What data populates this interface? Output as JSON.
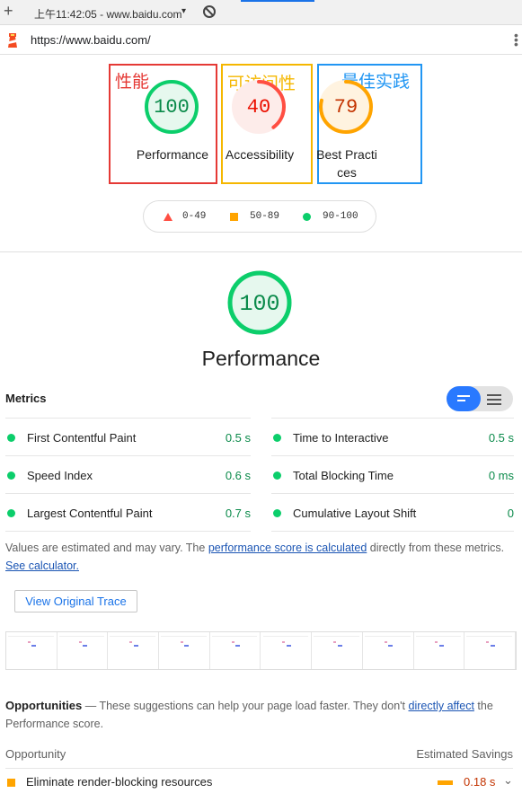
{
  "browser": {
    "tab_title": "上午11:42:05 - www.baidu.com",
    "url": "https://www.baidu.com/",
    "new_tab_glyph": "+",
    "menu_glyph": "⋮",
    "tab_caret": "▾"
  },
  "categories": [
    {
      "zh_label": "性能",
      "score": "100",
      "label": "Performance",
      "zh_color": "#e53935",
      "box_color": "#e53935",
      "score_color": "#0cce6b",
      "score_text_color": "#0a8a4a",
      "fill": 1.0
    },
    {
      "zh_label": "可访问性",
      "score": "40",
      "label": "Accessibility",
      "zh_color": "#f5b700",
      "box_color": "#f5b700",
      "score_color": "#ff4e42",
      "score_text_color": "#eb0f00",
      "fill": 0.4
    },
    {
      "zh_label": "最佳实践",
      "score": "79",
      "label": "Best Practices",
      "zh_color": "#2196f3",
      "box_color": "#2196f3",
      "score_color": "#ffa400",
      "score_text_color": "#c33300",
      "fill": 0.79
    }
  ],
  "legend": [
    {
      "range": "0-49",
      "shape": "triangle",
      "color": "#ff4e42"
    },
    {
      "range": "50-89",
      "shape": "square",
      "color": "#ffa400"
    },
    {
      "range": "90-100",
      "shape": "circle",
      "color": "#0cce6b"
    }
  ],
  "performance": {
    "score": "100",
    "title": "Performance",
    "fill": 1.0
  },
  "metrics": {
    "title": "Metrics",
    "left": [
      {
        "name": "First Contentful Paint",
        "value": "0.5 s"
      },
      {
        "name": "Speed Index",
        "value": "0.6 s"
      },
      {
        "name": "Largest Contentful Paint",
        "value": "0.7 s"
      }
    ],
    "right": [
      {
        "name": "Time to Interactive",
        "value": "0.5 s"
      },
      {
        "name": "Total Blocking Time",
        "value": "0 ms"
      },
      {
        "name": "Cumulative Layout Shift",
        "value": "0"
      }
    ]
  },
  "note": {
    "prefix": "Values are estimated and may vary. The ",
    "link1": "performance score is calculated",
    "middle": " directly from these metrics. ",
    "link2": "See calculator."
  },
  "trace_button": "View Original Trace",
  "opportunities": {
    "title": "Opportunities",
    "text_prefix": " — These suggestions can help your page load faster. They don't ",
    "link": "directly affect",
    "text_suffix": " the Performance score.",
    "col_left": "Opportunity",
    "col_right": "Estimated Savings",
    "rows": [
      {
        "name": "Eliminate render-blocking resources",
        "savings": "0.18 s",
        "chevron": "⌄"
      }
    ]
  }
}
